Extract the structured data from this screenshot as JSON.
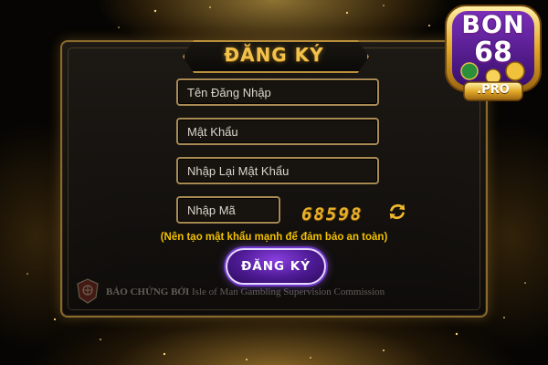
{
  "dialog": {
    "title": "ĐĂNG KÝ",
    "username_placeholder": "Tên Đăng Nhập",
    "password_placeholder": "Mật Khẩu",
    "confirm_password_placeholder": "Nhập Lại Mật Khẩu",
    "code_placeholder": "Nhập Mã",
    "captcha_code": "68598",
    "hint": "(Nên tạo mật khẩu mạnh để đảm bảo an toàn)",
    "submit_label": "ĐĂNG KÝ"
  },
  "footer": {
    "guarantee_label": "BẢO CHỨNG BỞI",
    "commission": "Isle of Man Gambling Supervision Commission"
  },
  "brand": {
    "name_top": "BON",
    "name_number": "68",
    "tld": ".PRO"
  },
  "colors": {
    "gold": "#f2c24a",
    "hint_yellow": "#f2c000",
    "button_purple": "#4d1a93",
    "field_border": "#a88a52"
  },
  "icons": {
    "refresh": "refresh-icon",
    "seal": "seal-icon"
  }
}
